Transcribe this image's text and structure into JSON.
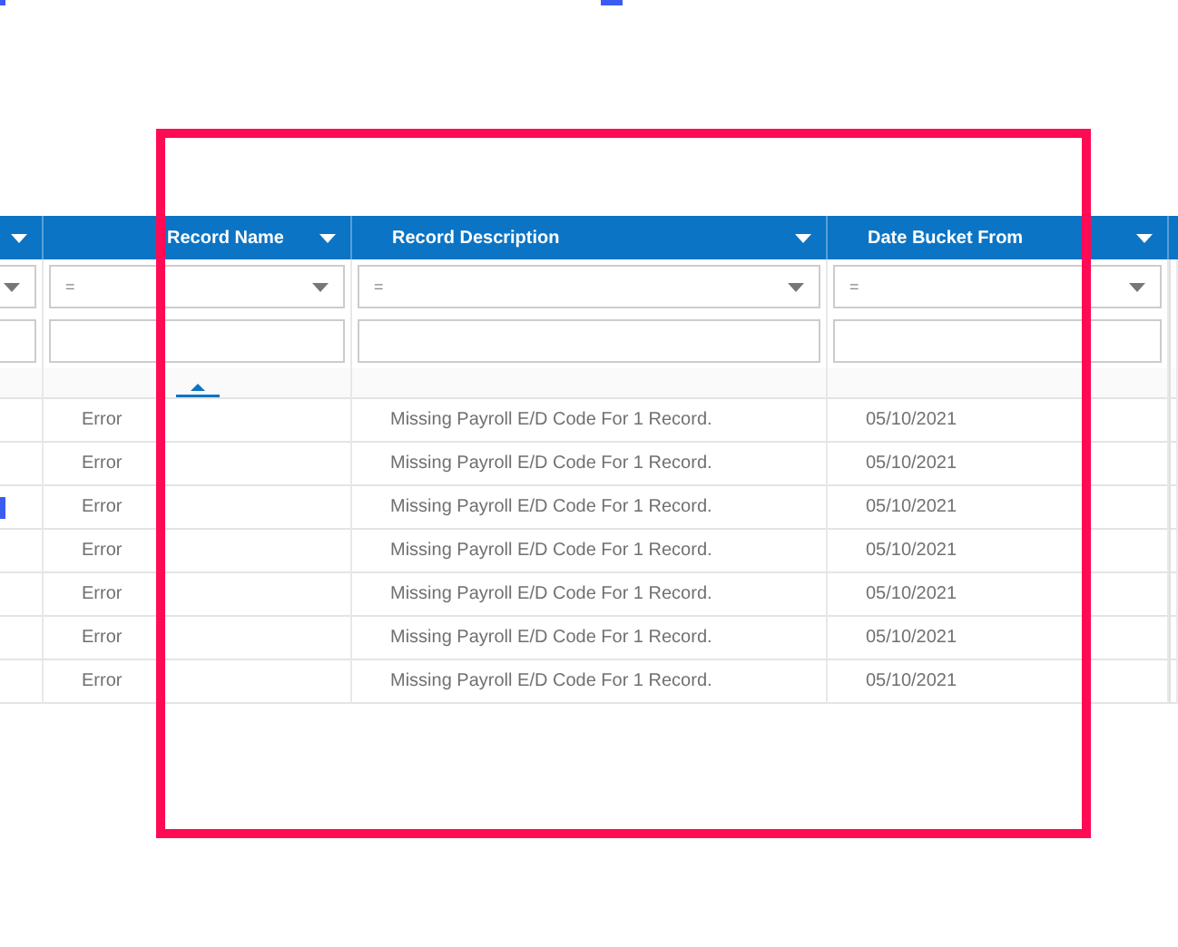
{
  "grid": {
    "columns": [
      {
        "label": "Record Name",
        "filter_operator": "=",
        "sorted": true
      },
      {
        "label": "Record Description",
        "filter_operator": "=",
        "sorted": false
      },
      {
        "label": "Date Bucket From",
        "filter_operator": "=",
        "sorted": false
      }
    ],
    "rows": [
      {
        "marked": false,
        "cells": [
          "Error",
          "Missing Payroll E/D Code For 1 Record.",
          "05/10/2021"
        ]
      },
      {
        "marked": false,
        "cells": [
          "Error",
          "Missing Payroll E/D Code For 1 Record.",
          "05/10/2021"
        ]
      },
      {
        "marked": true,
        "cells": [
          "Error",
          "Missing Payroll E/D Code For 1 Record.",
          "05/10/2021"
        ]
      },
      {
        "marked": false,
        "cells": [
          "Error",
          "Missing Payroll E/D Code For 1 Record.",
          "05/10/2021"
        ]
      },
      {
        "marked": false,
        "cells": [
          "Error",
          "Missing Payroll E/D Code For 1 Record.",
          "05/10/2021"
        ]
      },
      {
        "marked": false,
        "cells": [
          "Error",
          "Missing Payroll E/D Code For 1 Record.",
          "05/10/2021"
        ]
      },
      {
        "marked": false,
        "cells": [
          "Error",
          "Missing Payroll E/D Code For 1 Record.",
          "05/10/2021"
        ]
      }
    ]
  },
  "annotation": {
    "kind": "rectangle"
  }
}
